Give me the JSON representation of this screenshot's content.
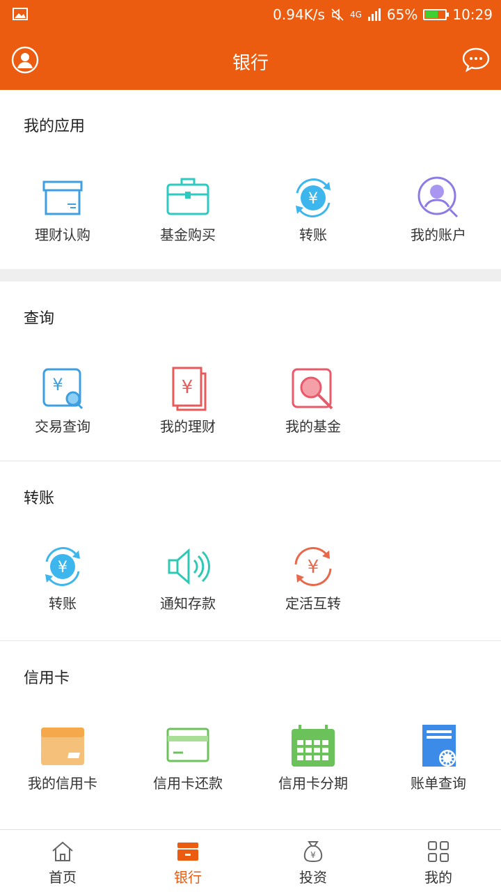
{
  "status_bar": {
    "network_speed": "0.94K/s",
    "signal": "4G",
    "battery": "65%",
    "battery_level": 0.65,
    "time": "10:29"
  },
  "app_bar": {
    "title": "银行",
    "left_icon": "profile-icon",
    "right_icon": "chat-icon"
  },
  "sections": {
    "my_apps": {
      "title": "我的应用",
      "items": [
        {
          "label": "理财认购",
          "icon": "box-icon",
          "color": "#3D9FE0"
        },
        {
          "label": "基金购买",
          "icon": "briefcase-icon",
          "color": "#2EC9C0"
        },
        {
          "label": "转账",
          "icon": "yen-transfer-icon",
          "color": "#3DB6EE"
        },
        {
          "label": "我的账户",
          "icon": "account-search-icon",
          "color": "#8C7BE3"
        }
      ]
    },
    "query": {
      "title": "查询",
      "items": [
        {
          "label": "交易查询",
          "icon": "transaction-search-icon",
          "color": "#3D9FE0"
        },
        {
          "label": "我的理财",
          "icon": "yen-document-icon",
          "color": "#E85A5A"
        },
        {
          "label": "我的基金",
          "icon": "fund-search-icon",
          "color": "#E85A6A"
        }
      ]
    },
    "transfer": {
      "title": "转账",
      "items": [
        {
          "label": "转账",
          "icon": "yen-transfer-icon",
          "color": "#3DB6EE"
        },
        {
          "label": "通知存款",
          "icon": "speaker-icon",
          "color": "#2EC9B5"
        },
        {
          "label": "定活互转",
          "icon": "yen-cycle-icon",
          "color": "#E8684A"
        }
      ]
    },
    "credit_card": {
      "title": "信用卡",
      "items": [
        {
          "label": "我的信用卡",
          "icon": "credit-card-icon",
          "color": "#F5A94B"
        },
        {
          "label": "信用卡还款",
          "icon": "card-repay-icon",
          "color": "#6CC25A"
        },
        {
          "label": "信用卡分期",
          "icon": "calendar-icon",
          "color": "#6CC25A"
        },
        {
          "label": "账单查询",
          "icon": "bill-icon",
          "color": "#3D8BE8"
        }
      ]
    }
  },
  "bottom_nav": {
    "active_color": "#EB5B10",
    "items": [
      {
        "label": "首页",
        "icon": "home-icon"
      },
      {
        "label": "银行",
        "icon": "bank-icon"
      },
      {
        "label": "投资",
        "icon": "money-bag-icon"
      },
      {
        "label": "我的",
        "icon": "grid-icon"
      }
    ]
  }
}
